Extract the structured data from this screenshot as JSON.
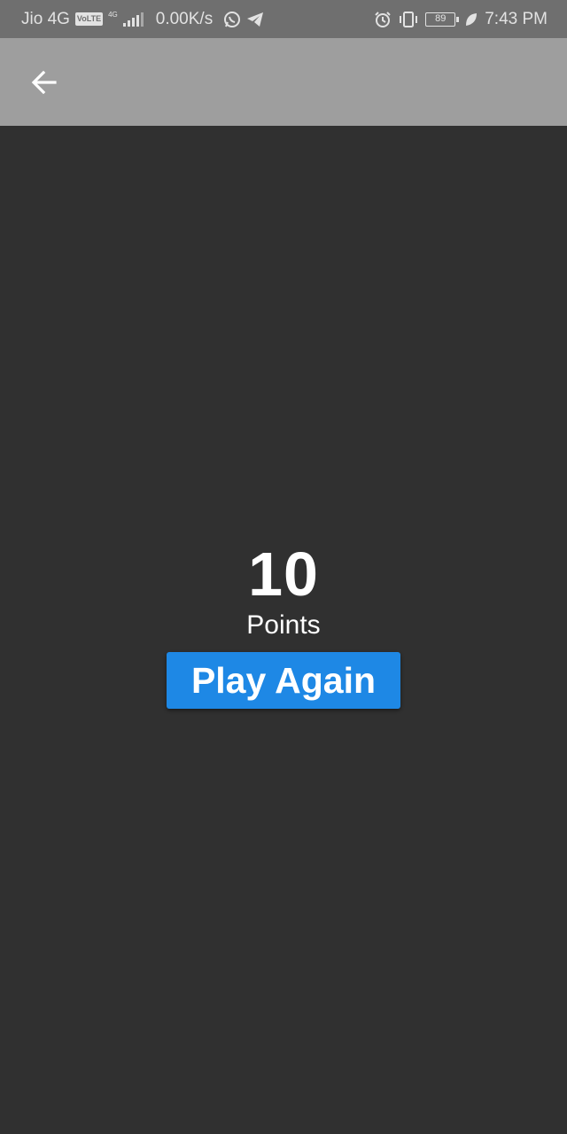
{
  "status_bar": {
    "carrier": "Jio 4G",
    "volte": "VoLTE",
    "network_type": "4G",
    "data_speed": "0.00K/s",
    "battery_level": "89",
    "time": "7:43 PM",
    "icons": [
      "whatsapp-icon",
      "telegram-icon",
      "alarm-icon",
      "vibrate-icon",
      "battery-icon",
      "battery-saver-leaf-icon"
    ]
  },
  "app_bar": {
    "back_icon": "arrow-left-icon"
  },
  "result": {
    "score": "10",
    "label": "Points",
    "play_again_label": "Play Again"
  },
  "colors": {
    "background": "#303030",
    "app_bar": "#9e9e9e",
    "status_bar": "#6f6f6f",
    "button": "#1e88e5"
  }
}
